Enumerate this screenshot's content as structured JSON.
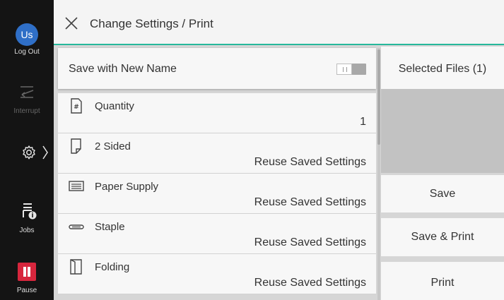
{
  "rail": {
    "user_initials": "Us",
    "logout_label": "Log Out",
    "interrupt_label": "Interrupt",
    "jobs_label": "Jobs",
    "pause_label": "Pause"
  },
  "header": {
    "title": "Change Settings / Print"
  },
  "save_option": {
    "label": "Save with New Name",
    "toggle_state": "off"
  },
  "settings": [
    {
      "title": "Quantity",
      "value": "1",
      "icon": "quantity-icon"
    },
    {
      "title": "2 Sided",
      "value": "Reuse Saved Settings",
      "icon": "two-sided-icon"
    },
    {
      "title": "Paper Supply",
      "value": "Reuse Saved Settings",
      "icon": "paper-supply-icon"
    },
    {
      "title": "Staple",
      "value": "Reuse Saved Settings",
      "icon": "staple-icon"
    },
    {
      "title": "Folding",
      "value": "Reuse Saved Settings",
      "icon": "folding-icon"
    }
  ],
  "right_panel": {
    "selected_files": "Selected Files (1)",
    "save": "Save",
    "save_print": "Save & Print",
    "print": "Print"
  },
  "colors": {
    "accent": "#27b89b",
    "avatar": "#2f6fc7",
    "pause": "#d7263d",
    "rail": "#141414"
  }
}
